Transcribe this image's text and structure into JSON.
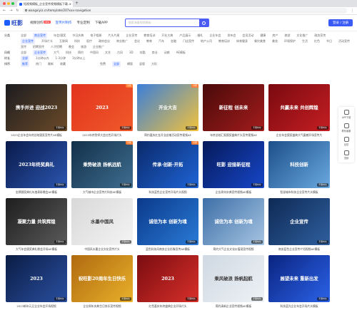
{
  "browser": {
    "tab_title": "短视频模板_企业宣传视频模板下载...",
    "url": "wangxiyiz.cn/template/207xxx-navigation"
  },
  "header": {
    "logo": "旺影",
    "nav": [
      {
        "label": "视频创作",
        "badge": "NEW"
      },
      {
        "label": "宣传片制作",
        "active": true
      },
      {
        "label": "专业定制"
      },
      {
        "label": "下载APP"
      }
    ],
    "search_placeholder": "搜索海量视频模板",
    "login_label": "登录 / 注册"
  },
  "filters": {
    "row1": {
      "label": "分类",
      "items": [
        "全部",
        "商业宣传",
        "年会/颁奖",
        "节日庆典",
        "电子相册",
        "片头片尾",
        "企业宣传",
        "教育培训",
        "开业大典",
        "产品展示",
        "婚礼",
        "企业年会",
        "发布会",
        "会员活动",
        "健康",
        "房产",
        "旅游",
        "文化推广",
        "政务宣传"
      ]
    },
    "row1_sub": {
      "items": [
        "企业宣传",
        "开场片头",
        "互联网",
        "科技",
        "医疗",
        "政府会议",
        "商业推广",
        "会议",
        "教育",
        "汽车",
        "金融",
        "门店宣传",
        "地产公司",
        "教育培训",
        "体育健身",
        "餐饮美食",
        "美妆",
        "环境保护",
        "生活",
        "红色",
        "节日",
        "活动宣传",
        "宣传",
        "招聘宣传",
        "人才招聘",
        "晚会",
        "旅游",
        "企业推广"
      ]
    },
    "row2": {
      "label": "风格",
      "items": [
        "全部",
        "企业宣传",
        "大气",
        "科技",
        "简约",
        "中国风",
        "文艺",
        "古风",
        "3D",
        "炫酷",
        "商业",
        "动感",
        "AE模板"
      ]
    },
    "row3": {
      "label": "时长",
      "items": [
        "全部",
        "1分钟以内",
        "1-3分钟",
        "3分钟以上"
      ]
    },
    "row4": {
      "label": "排序",
      "items": [
        "推荐",
        "热门",
        "最新",
        "收藏"
      ],
      "right": [
        "免费",
        "全部",
        "横版",
        "竖版",
        "方形"
      ]
    }
  },
  "cards": [
    {
      "title": "携手并进 迎战2023",
      "caption": "2023企业年会年终总结颁奖宣传片AE模板",
      "colors": [
        "#1c1c20",
        "#6b4a28"
      ],
      "chip": "不限时长"
    },
    {
      "title": "2023",
      "caption": "2023年终誓师大会红色开场片头",
      "colors": [
        "#e2331e",
        "#f05a2a"
      ],
      "chip": "不限时长",
      "tag": "付费"
    },
    {
      "title": "开业大吉",
      "caption": "简约喜庆红金开业店铺活动宣传视频AE",
      "colors": [
        "#3b7fd9",
        "#f2c23c"
      ],
      "chip": "不限时长",
      "tag": "付费"
    },
    {
      "title": "新征程 创未来",
      "caption": "年终总结汇报颁奖盛典片头宣传视频AE",
      "colors": [
        "#4a0a0a",
        "#a31c1c"
      ],
      "chip": "不限时长"
    },
    {
      "title": "共赢未来 共创辉煌",
      "caption": "企业年会颁奖盛典大气震撼开场宣传片",
      "colors": [
        "#7a0a0f",
        "#c41e23"
      ],
      "chip": "不限时长"
    },
    {
      "title": "2023年终奖典礼",
      "caption": "金牌颁奖典礼年度表彰晚会AE模板",
      "colors": [
        "#0a1a4a",
        "#2b56b0"
      ],
      "chip": "不限时长"
    },
    {
      "title": "乘势破浪 扬帆远航",
      "caption": "大气城市企业宣传片科技AE模板",
      "colors": [
        "#12304a",
        "#3f6d8f"
      ],
      "chip": "不限时长",
      "tag": "付费"
    },
    {
      "title": "传承·创新·开拓",
      "caption": "科技蓝色企业宣传开场片头视频",
      "colors": [
        "#0a2a6a",
        "#1e64d6"
      ],
      "chip": "不限时长",
      "tag": "付费"
    },
    {
      "title": "旺影 迎接新征程",
      "caption": "企业周年庆典宣传视频AE模板",
      "colors": [
        "#061a5a",
        "#1646c8"
      ],
      "chip": "不限时长"
    },
    {
      "title": "科技创新",
      "caption": "智慧城市科技企业宣传片头模板",
      "colors": [
        "#1c4f8a",
        "#6aa9e0"
      ],
      "chip": "不限时长"
    },
    {
      "title": "凝聚力量 共筑辉煌",
      "caption": "大气年会颁奖典礼晚会开场AE模板",
      "colors": [
        "#1e1e1e",
        "#5a5a5a"
      ],
      "chip": "不限时长"
    },
    {
      "title": "水墨中国风",
      "caption": "中国风水墨企业文化宣传片头",
      "colors": [
        "#d8d8d8",
        "#f4f4f4"
      ],
      "chip": "不限时长",
      "dark": true
    },
    {
      "title": "诚信为本 创新为魂",
      "caption": "蓝色科技风商务企业形象宣传AE模板",
      "colors": [
        "#0a3a8a",
        "#2a7ad6"
      ],
      "chip": "不限时长"
    },
    {
      "title": "诚信为本 创新为魂",
      "caption": "简约大气企业文化价值观宣传视频",
      "colors": [
        "#3d6fa8",
        "#a6c4e2"
      ],
      "chip": "不限时长"
    },
    {
      "title": "企业宣传",
      "caption": "商务蓝色企业宣传介绍视频AE模板",
      "colors": [
        "#0e2a55",
        "#2f5f9e"
      ],
      "chip": "不限时长"
    },
    {
      "title": "2023",
      "caption": "2023新年元旦企业年会开场视频",
      "colors": [
        "#0a1c44",
        "#2a4fa0"
      ],
      "chip": "不限时长"
    },
    {
      "title": "祝旺影20周年生日快乐",
      "caption": "企业周年庆典生日快乐宣传视频",
      "colors": [
        "#b06a10",
        "#e8b02a"
      ],
      "chip": "不限时长"
    },
    {
      "title": "2023",
      "caption": "红色喜庆年终盛典企业开场片头",
      "colors": [
        "#7a0c10",
        "#d8302a"
      ],
      "chip": "不限时长"
    },
    {
      "title": "乘风破浪 扬帆起航",
      "caption": "简约清新企业宣传视频AE模板",
      "colors": [
        "#cfd8e2",
        "#eef2f6"
      ],
      "chip": "不限时长",
      "dark": true
    },
    {
      "title": "展望未来 重新出发",
      "caption": "科技蓝光企业年会开场片头模板",
      "colors": [
        "#0a2480",
        "#2b62e8"
      ],
      "chip": "不限时长"
    }
  ],
  "side": [
    {
      "label": "APP下载"
    },
    {
      "label": "联系客服"
    },
    {
      "label": "反馈"
    },
    {
      "label": "顶部"
    }
  ]
}
